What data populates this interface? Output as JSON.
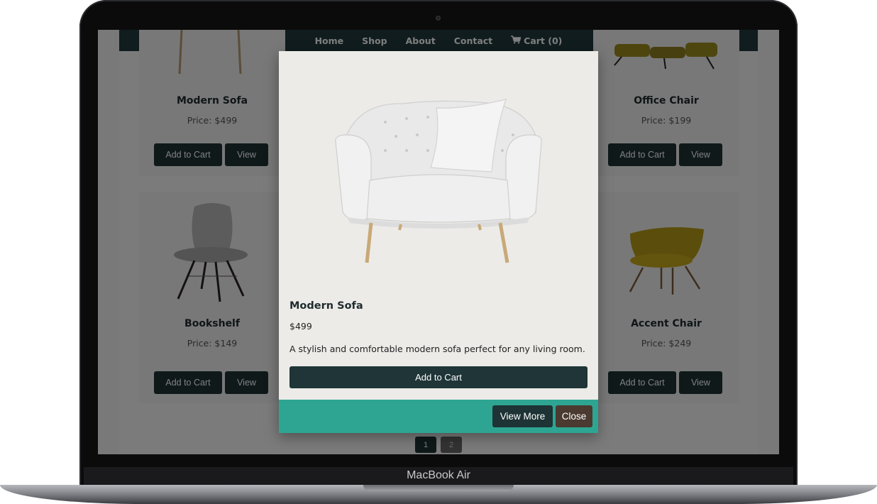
{
  "device": {
    "label": "MacBook Air"
  },
  "nav": {
    "items": [
      "Home",
      "Shop",
      "About",
      "Contact"
    ],
    "cart_label": "Cart (0)"
  },
  "products": [
    {
      "name": "Modern Sofa",
      "price": "Price: $499",
      "add_label": "Add to Cart",
      "view_label": "View"
    },
    {
      "name": "Office Chair",
      "price": "Price: $199",
      "add_label": "Add to Cart",
      "view_label": "View"
    },
    {
      "name": "Bookshelf",
      "price": "Price: $149",
      "add_label": "Add to Cart",
      "view_label": "View"
    },
    {
      "name": "Accent Chair",
      "price": "Price: $249",
      "add_label": "Add to Cart",
      "view_label": "View"
    }
  ],
  "pagination": {
    "pages": [
      "1",
      "2"
    ],
    "active": "1"
  },
  "modal": {
    "title": "Modern Sofa",
    "price": "$499",
    "description": "A stylish and comfortable modern sofa perfect for any living room.",
    "add_label": "Add to Cart",
    "view_more_label": "View More",
    "close_label": "Close"
  },
  "colors": {
    "nav_bg": "#20393b",
    "button_dark": "#1e3335",
    "modal_footer": "#2ea592",
    "close_button": "#4a3a30"
  },
  "icons": {
    "cart": "cart-icon"
  }
}
